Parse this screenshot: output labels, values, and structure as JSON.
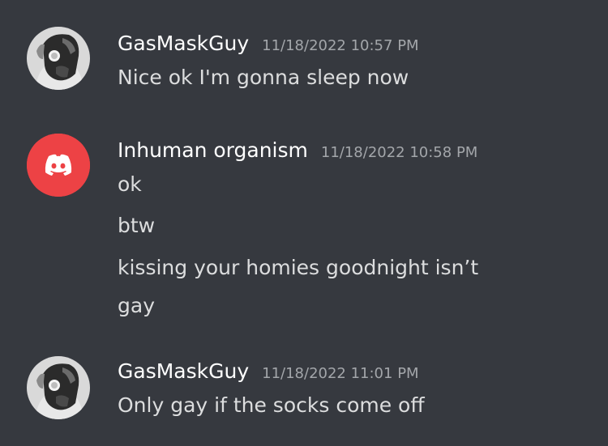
{
  "messages": [
    {
      "username": "GasMaskGuy",
      "timestamp": "11/18/2022 10:57 PM",
      "avatar_icon": "gas-mask-avatar-icon",
      "lines": [
        "Nice ok I'm gonna sleep now"
      ]
    },
    {
      "username": "Inhuman organism",
      "timestamp": "11/18/2022 10:58 PM",
      "avatar_icon": "discord-default-avatar-icon",
      "avatar_color": "#ed4245",
      "lines": [
        "ok",
        "btw",
        "kissing your homies goodnight isn’t",
        "gay"
      ]
    },
    {
      "username": "GasMaskGuy",
      "timestamp": "11/18/2022 11:01 PM",
      "avatar_icon": "gas-mask-avatar-icon",
      "lines": [
        "Only gay if the socks come off"
      ]
    }
  ],
  "colors": {
    "background": "#36393f",
    "username": "#ffffff",
    "timestamp": "#a3a6aa",
    "message_text": "#dcddde"
  }
}
